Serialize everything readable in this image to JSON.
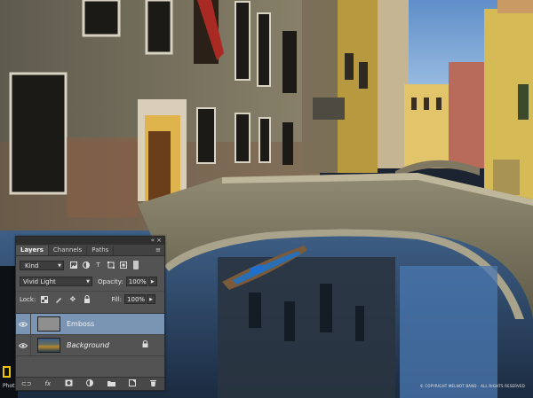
{
  "panel": {
    "tabs": [
      {
        "label": "Layers",
        "active": true
      },
      {
        "label": "Channels",
        "active": false
      },
      {
        "label": "Paths",
        "active": false
      }
    ],
    "collapse_label": "«",
    "close_label": "×",
    "menu_label": "≡",
    "filter": {
      "kind_label": "Kind",
      "icons": [
        "image-filter-icon",
        "adjustment-filter-icon",
        "type-filter-icon",
        "shape-filter-icon",
        "smart-object-filter-icon"
      ]
    },
    "blend_mode": "Vivid Light",
    "opacity_label": "Opacity:",
    "opacity_value": "100%",
    "lock_label": "Lock:",
    "fill_label": "Fill:",
    "fill_value": "100%",
    "layers": [
      {
        "name": "Emboss",
        "selected": true,
        "visible": true,
        "thumbnail": "gray"
      },
      {
        "name": "Background",
        "selected": false,
        "visible": true,
        "thumbnail": "photo",
        "locked": true
      }
    ],
    "bottom_icons": [
      "link-layers-icon",
      "fx-icon",
      "add-mask-icon",
      "adjustment-layer-icon",
      "new-group-icon",
      "new-layer-icon",
      "delete-layer-icon"
    ]
  },
  "footer": {
    "left_text": "Phot",
    "copyright": "© COPYRIGHT MELNOT BAND · ALL RIGHTS RESERVED"
  },
  "colors": {
    "panel_bg": "#535353",
    "selected_layer": "#7a95b3",
    "logo_yellow": "#f2c500"
  }
}
